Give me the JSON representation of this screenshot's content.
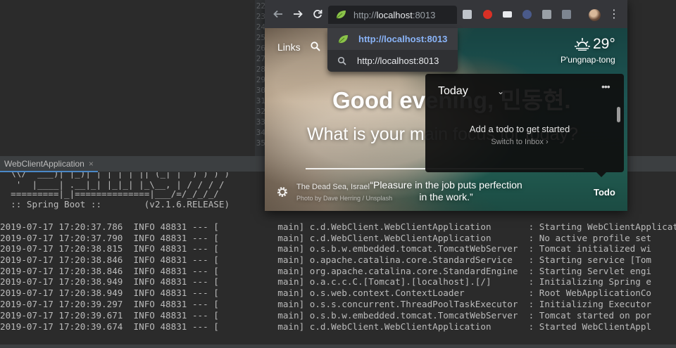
{
  "ide": {
    "line_numbers": [
      "22",
      "23",
      "24",
      "25",
      "26",
      "27",
      "28",
      "29",
      "30",
      "31",
      "32",
      "33",
      "34",
      "35"
    ],
    "run_tab": {
      "label": "WebClientApplication",
      "close": "×"
    },
    "banner": [
      "  \\\\/  ___)| |_)| | | | | || (_| |  ) ) ) )",
      "   '  |____| .__|_| |_|_| |_\\__, | / / / /",
      "  =========|_|==============|___/=/_/_/_/",
      "  :: Spring Boot ::        (v2.1.6.RELEASE)"
    ],
    "log_lines": [
      "2019-07-17 17:20:37.786  INFO 48831 --- [           main] c.d.WebClient.WebClientApplication       : Starting WebClientApplication",
      "2019-07-17 17:20:37.790  INFO 48831 --- [           main] c.d.WebClient.WebClientApplication       : No active profile set",
      "2019-07-17 17:20:38.815  INFO 48831 --- [           main] o.s.b.w.embedded.tomcat.TomcatWebServer  : Tomcat initialized wi",
      "2019-07-17 17:20:38.846  INFO 48831 --- [           main] o.apache.catalina.core.StandardService   : Starting service [Tom",
      "2019-07-17 17:20:38.846  INFO 48831 --- [           main] org.apache.catalina.core.StandardEngine  : Starting Servlet engi",
      "2019-07-17 17:20:38.949  INFO 48831 --- [           main] o.a.c.c.C.[Tomcat].[localhost].[/]       : Initializing Spring e",
      "2019-07-17 17:20:38.949  INFO 48831 --- [           main] o.s.web.context.ContextLoader            : Root WebApplicationCo",
      "2019-07-17 17:20:39.297  INFO 48831 --- [           main] o.s.s.concurrent.ThreadPoolTaskExecutor  : Initializing Executor",
      "2019-07-17 17:20:39.671  INFO 48831 --- [           main] o.s.b.w.embedded.tomcat.TomcatWebServer  : Tomcat started on por",
      "2019-07-17 17:20:39.674  INFO 48831 --- [           main] c.d.WebClient.WebClientApplication       : Started WebClientAppl"
    ]
  },
  "browser": {
    "omnibox": {
      "host_prefix": "http://",
      "host": "localhost",
      "port": ":8013"
    },
    "suggestions": [
      {
        "text": "http://localhost:8013",
        "icon": "leaf-icon"
      },
      {
        "text": "http://localhost:8013",
        "icon": "search-icon"
      }
    ],
    "colors": {
      "toolbar": "#35363a",
      "suggestion_selected": "#8ab4f8",
      "leaf": "#8bc34a"
    }
  },
  "momentum": {
    "links": "Links",
    "weather": {
      "temp": "29°",
      "location": "P'ungnap-tong",
      "icon": "sunrise-icon"
    },
    "greeting": "Good evening, 민동현.",
    "question": "What is your main focus for today?",
    "photo": {
      "location": "The Dead Sea, Israel",
      "credit": "Photo by Dave Herring / Unsplash"
    },
    "quote": "“Pleasure in the job puts perfection in the work.”",
    "todo_button": "Todo",
    "todo_panel": {
      "list": "Today",
      "more": "•••",
      "empty": "Add a todo to get started",
      "switch": "Switch to Inbox ›"
    }
  }
}
